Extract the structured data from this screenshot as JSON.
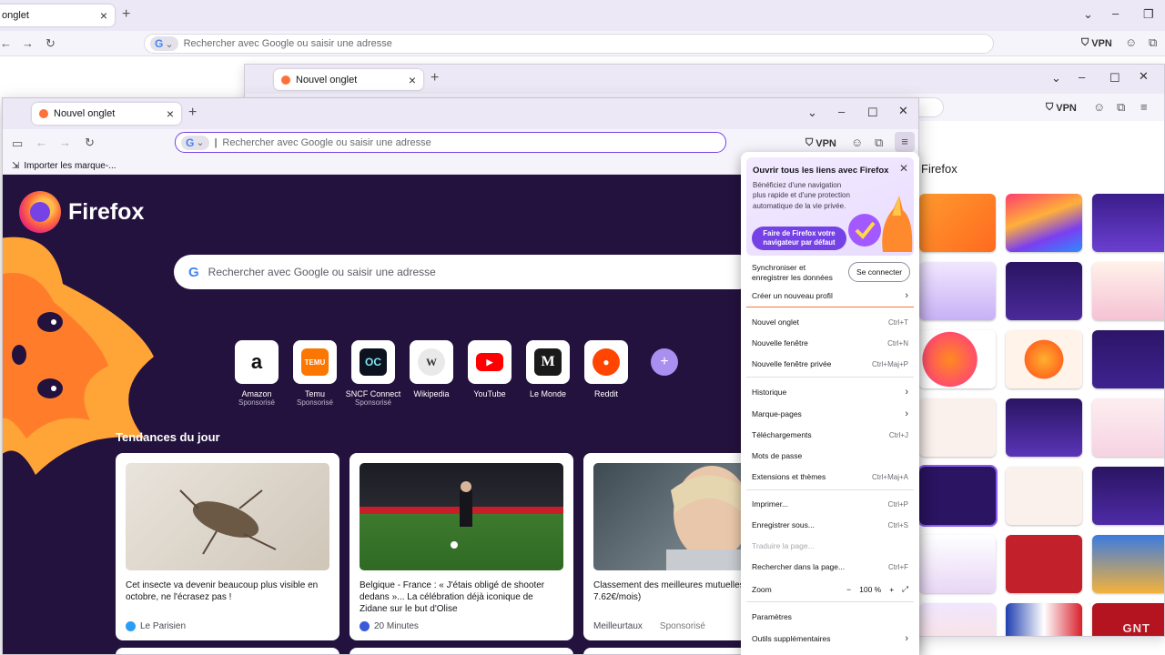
{
  "back_window": {
    "tab_label": "onglet",
    "url_placeholder": "Rechercher avec Google ou saisir une adresse",
    "vpn_label": "VPN"
  },
  "mid_window": {
    "tab_label": "Nouvel onglet",
    "vpn_label": "VPN",
    "panel_title": "Firefox"
  },
  "front_window": {
    "tab_label": "Nouvel onglet",
    "url_placeholder": "Rechercher avec Google ou saisir une adresse",
    "vpn_label": "VPN",
    "bookmark_import": "Importer les marque-...",
    "brand": "Firefox",
    "search_placeholder": "Rechercher avec Google ou saisir une adresse",
    "shortcuts": [
      {
        "label": "Amazon",
        "sub": "Sponsorisé",
        "glyph": "a",
        "color": "#ffffff"
      },
      {
        "label": "Temu",
        "sub": "Sponsorisé",
        "glyph": "TEMU",
        "color": "#fb7701"
      },
      {
        "label": "SNCF Connect",
        "sub": "Sponsorisé",
        "glyph": "OC",
        "color": "#0c131f"
      },
      {
        "label": "Wikipedia",
        "sub": "",
        "glyph": "W",
        "color": "#e9e9e9"
      },
      {
        "label": "YouTube",
        "sub": "",
        "glyph": "▶",
        "color": "#ff0000"
      },
      {
        "label": "Le Monde",
        "sub": "",
        "glyph": "M",
        "color": "#1a1a1a"
      },
      {
        "label": "Reddit",
        "sub": "",
        "glyph": "●",
        "color": "#ff4500"
      }
    ],
    "trends_title": "Tendances du jour",
    "cards": [
      {
        "title": "Cet insecte va devenir beaucoup plus visible en octobre, ne l'écrasez pas !",
        "source": "Le Parisien",
        "sponsor": "",
        "src_color": "#2a9df4"
      },
      {
        "title": "Belgique - France : « J'étais obligé de shooter dedans »... La célébration déjà iconique de Zidane sur le but d'Olise",
        "source": "20 Minutes",
        "sponsor": "",
        "src_color": "#3b5bdb"
      },
      {
        "title": "Classement des meilleures mutuelles",
        "title2": "7.62€/mois)",
        "source": "Meilleurtaux",
        "sponsor": "Sponsorisé",
        "src_color": ""
      }
    ]
  },
  "menu": {
    "promo_title": "Ouvrir tous les liens avec Firefox",
    "promo_text": "Bénéficiez d'une navigation plus rapide et d'une protection automatique de la vie privée.",
    "promo_button": "Faire de Firefox votre navigateur par défaut",
    "sync_text": "Synchroniser et enregistrer les données",
    "sync_button": "Se connecter",
    "new_profile": "Créer un nouveau profil",
    "new_tab": "Nouvel onglet",
    "new_tab_key": "Ctrl+T",
    "new_window": "Nouvelle fenêtre",
    "new_window_key": "Ctrl+N",
    "private_window": "Nouvelle fenêtre privée",
    "private_window_key": "Ctrl+Maj+P",
    "history": "Historique",
    "bookmarks": "Marque-pages",
    "downloads": "Téléchargements",
    "downloads_key": "Ctrl+J",
    "passwords": "Mots de passe",
    "extensions": "Extensions et thèmes",
    "extensions_key": "Ctrl+Maj+A",
    "print": "Imprimer...",
    "print_key": "Ctrl+P",
    "save_as": "Enregistrer sous...",
    "save_as_key": "Ctrl+S",
    "translate": "Traduire la page...",
    "find": "Rechercher dans la page...",
    "find_key": "Ctrl+F",
    "zoom": "Zoom",
    "zoom_minus": "−",
    "zoom_value": "100 %",
    "zoom_plus": "+",
    "settings": "Paramètres",
    "more_tools": "Outils supplémentaires"
  },
  "watermark": "GNT",
  "colors": {
    "accent": "#7542e5",
    "newtab_bg": "#24123e",
    "url_focus": "#7542e5"
  }
}
